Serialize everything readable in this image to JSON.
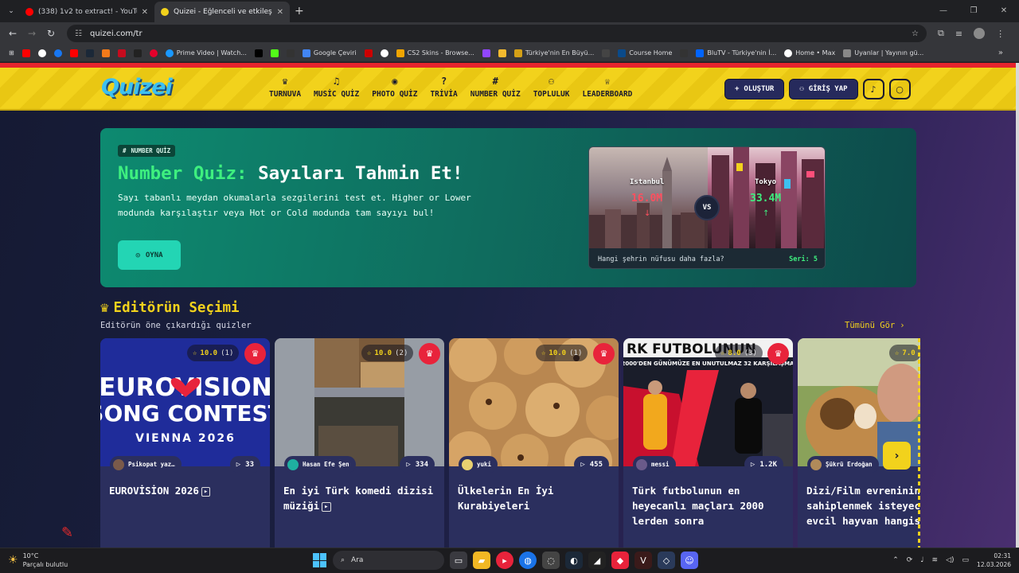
{
  "browser": {
    "tabs": [
      {
        "title": "(338) 1v2 to extract! - YouTube",
        "active": false
      },
      {
        "title": "Quizei - Eğlenceli ve etkileşimli",
        "active": true
      }
    ],
    "url": "quizei.com/tr",
    "bookmarks": [
      "Prime Video | Watch...",
      "Google Çeviri",
      "CS2 Skins - Browse...",
      "Türkiye'nin En Büyü...",
      "Course Home",
      "BluTV - Türkiye'nin İ...",
      "Home • Max",
      "Uyanlar | Yayının gü..."
    ]
  },
  "header": {
    "logo": "Quizei",
    "nav": [
      {
        "icon": "♛",
        "label": "TURNUVA"
      },
      {
        "icon": "♫",
        "label": "MUSİC QUİZ"
      },
      {
        "icon": "◉",
        "label": "PHOTO QUİZ"
      },
      {
        "icon": "?",
        "label": "TRİVİA"
      },
      {
        "icon": "#",
        "label": "NUMBER QUİZ"
      },
      {
        "icon": "⚇",
        "label": "TOPLULUK"
      },
      {
        "icon": "♕",
        "label": "LEADERBOARD"
      }
    ],
    "create_label": "OLUŞTUR",
    "login_label": "GİRİŞ YAP"
  },
  "hero": {
    "badge": "NUMBER QUİZ",
    "title_accent": "Number Quiz:",
    "title_rest": "Sayıları Tahmin Et!",
    "description": "Sayı tabanlı meydan okumalarla sezgilerini test et. Higher or Lower modunda karşılaştır veya Hot or Cold modunda tam sayıyı bul!",
    "play_label": "OYNA",
    "compare": {
      "left_city": "Istanbul",
      "left_value": "16.0M",
      "right_city": "Tokyo",
      "right_value": "33.4M",
      "vs": "VS",
      "question": "Hangi şehrin nüfusu daha fazla?",
      "streak": "Seri: 5"
    }
  },
  "section": {
    "title": "Editörün Seçimi",
    "subtitle": "Editörün öne çıkardığı quizler",
    "see_all": "Tümünü Gör"
  },
  "cards": [
    {
      "rating": "10.0",
      "count": "(1)",
      "author": "Psikopat yaz…",
      "plays": "33",
      "title": "EUROVİSİON 2026",
      "video": true
    },
    {
      "rating": "10.0",
      "count": "(2)",
      "author": "Hasan Efe Şen",
      "plays": "334",
      "title": "En iyi Türk komedi dizisi müziği",
      "video": true
    },
    {
      "rating": "10.0",
      "count": "(1)",
      "author": "yuki",
      "plays": "455",
      "title": "Ülkelerin En İyi Kurabiyeleri",
      "video": false
    },
    {
      "rating": "8.0",
      "count": "(3)",
      "author": "messi",
      "plays": "1.2K",
      "title": "Türk futbolunun en heyecanlı maçları 2000 lerden sonra",
      "video": false
    },
    {
      "rating": "7.0",
      "count": "",
      "author": "Şükrü Erdoğan",
      "plays": "",
      "title": "Dizi/Film evreninin sahiplenmek isteyeceğin evcil hayvan hangisidir?",
      "video": false
    }
  ],
  "thumb_text": {
    "euro1": "EUROVISION",
    "euro2": "SONG CONTEST",
    "euro3": "VIENNA 2026",
    "foot1": "RK FUTBOLUNUN",
    "foot2": "2000'DEN GÜNÜMÜZE EN UNUTULMAZ 32 KARŞILAŞMA"
  },
  "taskbar": {
    "temp": "10°C",
    "weather": "Parçalı bulutlu",
    "search": "Ara",
    "time": "02:31",
    "date": "12.03.2026"
  }
}
